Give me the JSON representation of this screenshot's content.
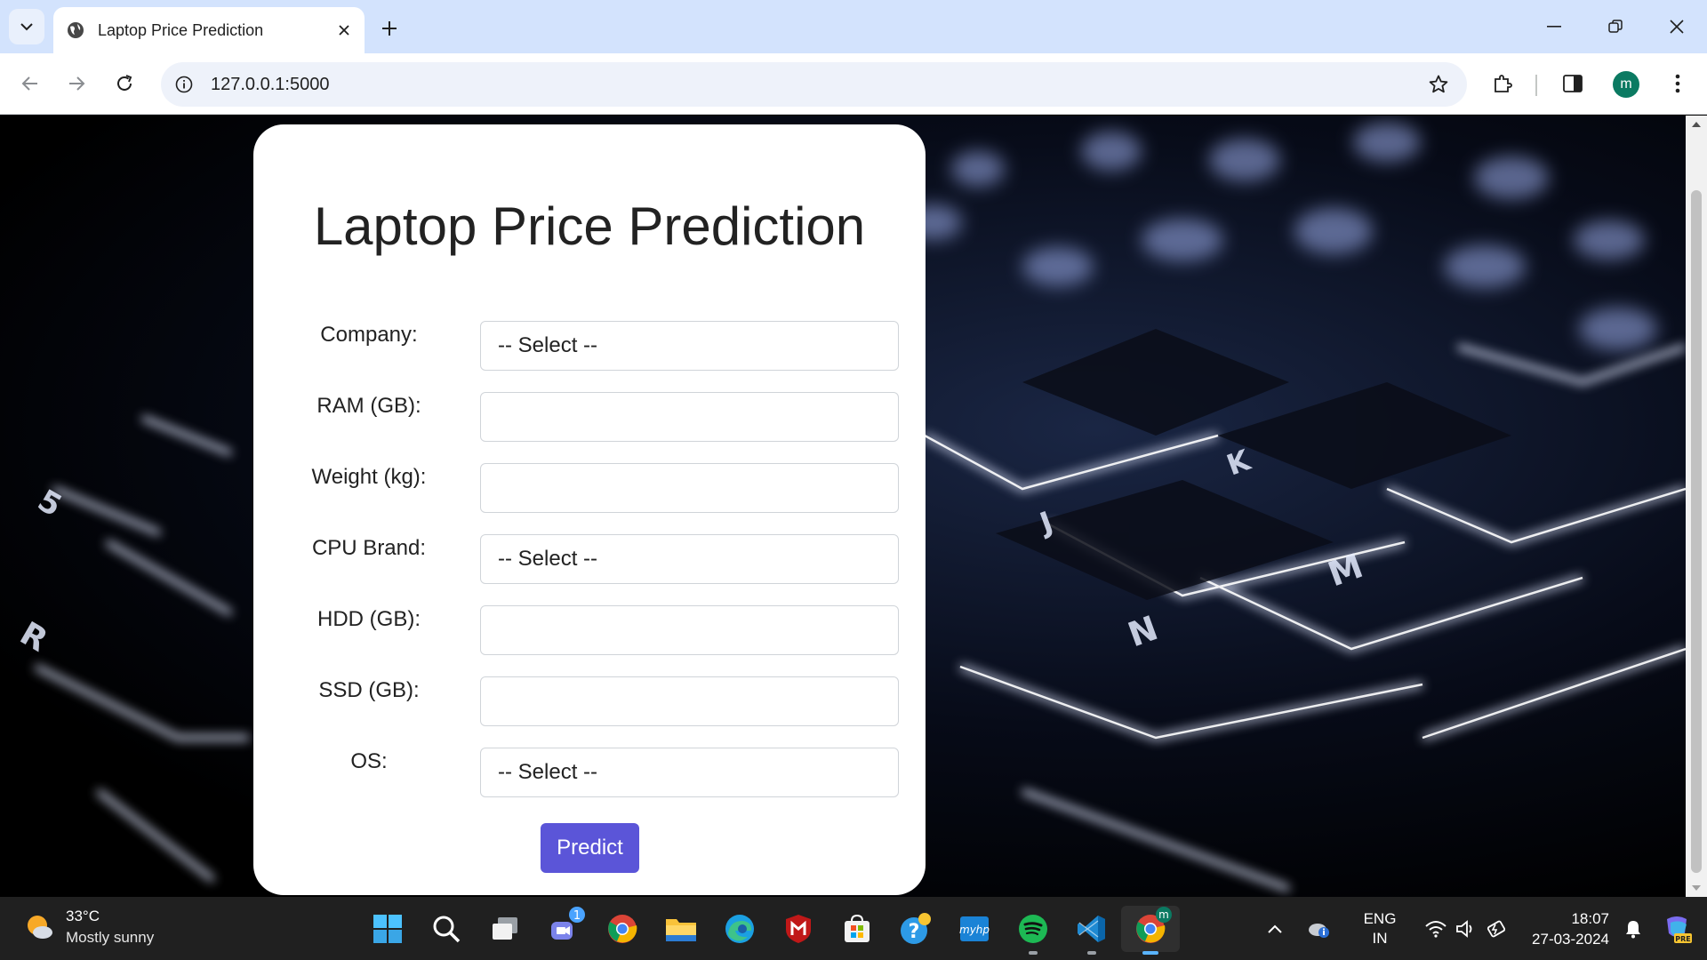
{
  "browser": {
    "tab_title": "Laptop Price Prediction",
    "url": "127.0.0.1:5000",
    "profile_initial": "m"
  },
  "form": {
    "title": "Laptop Price Prediction",
    "fields": [
      {
        "label": "Company:",
        "type": "select",
        "value": "-- Select --"
      },
      {
        "label": "RAM (GB):",
        "type": "input",
        "value": ""
      },
      {
        "label": "Weight (kg):",
        "type": "input",
        "value": ""
      },
      {
        "label": "CPU Brand:",
        "type": "select",
        "value": "-- Select --"
      },
      {
        "label": "HDD (GB):",
        "type": "input",
        "value": ""
      },
      {
        "label": "SSD (GB):",
        "type": "input",
        "value": ""
      },
      {
        "label": "OS:",
        "type": "select",
        "value": "-- Select --"
      }
    ],
    "submit_label": "Predict",
    "accent_color": "#5b55d8"
  },
  "taskbar": {
    "weather_temp": "33°C",
    "weather_condition": "Mostly sunny",
    "teams_badge": "1",
    "chrome_profile_badge": "m",
    "lang_primary": "ENG",
    "lang_secondary": "IN",
    "time": "18:07",
    "date": "27-03-2024",
    "pinned_apps": [
      "start-icon",
      "search-icon",
      "task-view-icon",
      "teams-icon",
      "chrome-icon",
      "file-explorer-icon",
      "edge-icon",
      "mcafee-icon",
      "microsoft-store-icon",
      "get-help-icon",
      "myhp-icon",
      "spotify-icon",
      "vscode-icon",
      "chrome-active-icon"
    ]
  }
}
